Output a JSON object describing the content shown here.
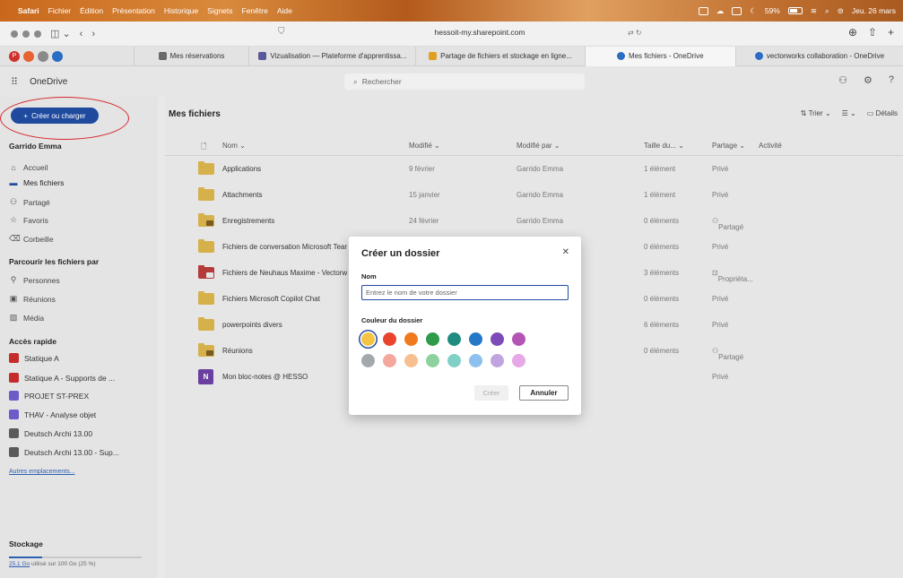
{
  "menubar": {
    "app": "Safari",
    "items": [
      "Fichier",
      "Édition",
      "Présentation",
      "Historique",
      "Signets",
      "Fenêtre",
      "Aide"
    ],
    "battery": "59%",
    "datetime": "Jeu. 26 mars"
  },
  "browser": {
    "address": "hessoit-my.sharepoint.com",
    "tabs": [
      {
        "label": "Mes réservations",
        "color": "#6a6a6a"
      },
      {
        "label": "Vizualisation — Plateforme d'apprentissa...",
        "color": "#5a5a9a"
      },
      {
        "label": "Partage de fichiers et stockage en ligne...",
        "color": "#e0a020"
      },
      {
        "label": "Mes fichiers - OneDrive",
        "color": "#2b6cc4"
      },
      {
        "label": "vectorworks collaboration - OneDrive",
        "color": "#2b6cc4"
      }
    ]
  },
  "header": {
    "app_title": "OneDrive",
    "search_placeholder": "Rechercher"
  },
  "sidebar": {
    "create_label": "Créer ou charger",
    "user": "Garrido Emma",
    "nav": [
      {
        "label": "Accueil",
        "icon": "home-icon"
      },
      {
        "label": "Mes fichiers",
        "icon": "folder-icon"
      },
      {
        "label": "Partagé",
        "icon": "people-icon"
      },
      {
        "label": "Favoris",
        "icon": "star-icon"
      },
      {
        "label": "Corbeille",
        "icon": "trash-icon"
      }
    ],
    "browse_heading": "Parcourir les fichiers par",
    "browse": [
      {
        "label": "Personnes",
        "icon": "person-icon"
      },
      {
        "label": "Réunions",
        "icon": "calendar-icon"
      },
      {
        "label": "Média",
        "icon": "image-icon"
      }
    ],
    "quick_heading": "Accès rapide",
    "quick": [
      {
        "label": "Statique A",
        "color": "#c62b2b"
      },
      {
        "label": "Statique A - Supports de ...",
        "color": "#c62b2b"
      },
      {
        "label": "PROJET ST-PREX",
        "color": "#6c5bc9"
      },
      {
        "label": "THAV - Analyse objet",
        "color": "#6c5bc9"
      },
      {
        "label": "Deutsch Archi 13.00",
        "color": "#5a5a5a"
      },
      {
        "label": "Deutsch Archi 13.00 - Sup...",
        "color": "#5a5a5a"
      }
    ],
    "more_link": "Autres emplacements...",
    "storage_heading": "Stockage",
    "storage_used": "25.1 Go",
    "storage_text": "utilisé sur 100 Go (25 %)",
    "storage_fraction": 0.25
  },
  "main": {
    "title": "Mes fichiers",
    "sort_label": "Trier",
    "details_label": "Détails",
    "columns": {
      "name": "Nom ⌄",
      "modified": "Modifié ⌄",
      "modified_by": "Modifié par ⌄",
      "size": "Taille du... ⌄",
      "sharing": "Partage ⌄",
      "activity": "Activité"
    },
    "rows": [
      {
        "name": "Applications",
        "modified": "9 février",
        "by": "Garrido Emma",
        "size": "1 élément",
        "share": "Privé",
        "type": "folder"
      },
      {
        "name": "Attachments",
        "modified": "15 janvier",
        "by": "Garrido Emma",
        "size": "1 élément",
        "share": "Privé",
        "type": "folder"
      },
      {
        "name": "Enregistrements",
        "modified": "24 février",
        "by": "Garrido Emma",
        "size": "0 éléments",
        "share": "Partagé",
        "type": "folder-shared"
      },
      {
        "name": "Fichiers de conversation Microsoft Tear",
        "modified": "",
        "by": "",
        "size": "0 éléments",
        "share": "Privé",
        "type": "folder"
      },
      {
        "name": "Fichiers de Neuhaus Maxime - Vectorw",
        "modified": "",
        "by": "",
        "size": "3 éléments",
        "share": "Propriéta...",
        "type": "folder-red"
      },
      {
        "name": "Fichiers Microsoft Copilot Chat",
        "modified": "",
        "by": "",
        "size": "0 éléments",
        "share": "Privé",
        "type": "folder"
      },
      {
        "name": "powerpoints divers",
        "modified": "",
        "by": "",
        "size": "6 éléments",
        "share": "Privé",
        "type": "folder"
      },
      {
        "name": "Réunions",
        "modified": "",
        "by": "",
        "size": "0 éléments",
        "share": "Partagé",
        "type": "folder-shared"
      },
      {
        "name": "Mon bloc-notes @ HESSO",
        "modified": "",
        "by": "",
        "size": "",
        "share": "Privé",
        "type": "onenote"
      }
    ]
  },
  "dialog": {
    "title": "Créer un dossier",
    "name_label": "Nom",
    "name_placeholder": "Entrez le nom de votre dossier",
    "color_label": "Couleur du dossier",
    "colors_row1": [
      "#f5c443",
      "#e8442e",
      "#f07a1e",
      "#2e9b4a",
      "#1f8c82",
      "#2478c7",
      "#7c4bb8",
      "#b455b6"
    ],
    "colors_row2": [
      "#a3a8ad",
      "#f4a79d",
      "#f7bf8f",
      "#8fd19e",
      "#80d0c8",
      "#8cc0ee",
      "#c0a4e0",
      "#e6a8e6"
    ],
    "create_label": "Créer",
    "cancel_label": "Annuler"
  }
}
